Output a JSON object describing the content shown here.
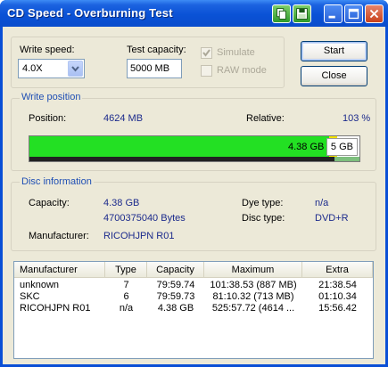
{
  "window": {
    "title": "CD Speed - Overburning Test"
  },
  "settings": {
    "write_speed_label": "Write speed:",
    "write_speed_value": "4.0X",
    "test_capacity_label": "Test capacity:",
    "test_capacity_value": "5000 MB",
    "simulate_label": "Simulate",
    "simulate_checked": true,
    "raw_mode_label": "RAW mode",
    "raw_mode_checked": false
  },
  "buttons": {
    "start_label": "Start",
    "close_label": "Close"
  },
  "write_position": {
    "group_label": "Write position",
    "position_label": "Position:",
    "position_value": "4624 MB",
    "relative_label": "Relative:",
    "relative_value": "103 %",
    "bar_written_fraction": 0.9248,
    "bar_disc_capacity_label": "4.38 GB",
    "bar_test_capacity_label": "5 GB",
    "bar_colors": {
      "written": "#23e023",
      "overburn_marker": "#f5e400"
    }
  },
  "disc_information": {
    "group_label": "Disc information",
    "capacity_label": "Capacity:",
    "capacity_value": "4.38 GB",
    "capacity_bytes": "4700375040 Bytes",
    "manufacturer_label": "Manufacturer:",
    "manufacturer_value": "RICOHJPN R01",
    "dye_type_label": "Dye type:",
    "dye_type_value": "n/a",
    "disc_type_label": "Disc type:",
    "disc_type_value": "DVD+R"
  },
  "results_table": {
    "columns": [
      "Manufacturer",
      "Type",
      "Capacity",
      "Maximum",
      "Extra"
    ],
    "rows": [
      [
        "unknown",
        "7",
        "79:59.74",
        "101:38.53 (887 MB)",
        "21:38.54"
      ],
      [
        "SKC",
        "6",
        "79:59.73",
        "81:10.32 (713 MB)",
        "01:10.34"
      ],
      [
        "RICOHJPN R01",
        "n/a",
        "4.38 GB",
        "525:57.72 (4614 ...",
        "15:56.42"
      ]
    ]
  },
  "icons": {
    "titlebar": [
      "copy-icon",
      "save-icon",
      "minimize-icon",
      "maximize-icon",
      "close-icon"
    ]
  }
}
